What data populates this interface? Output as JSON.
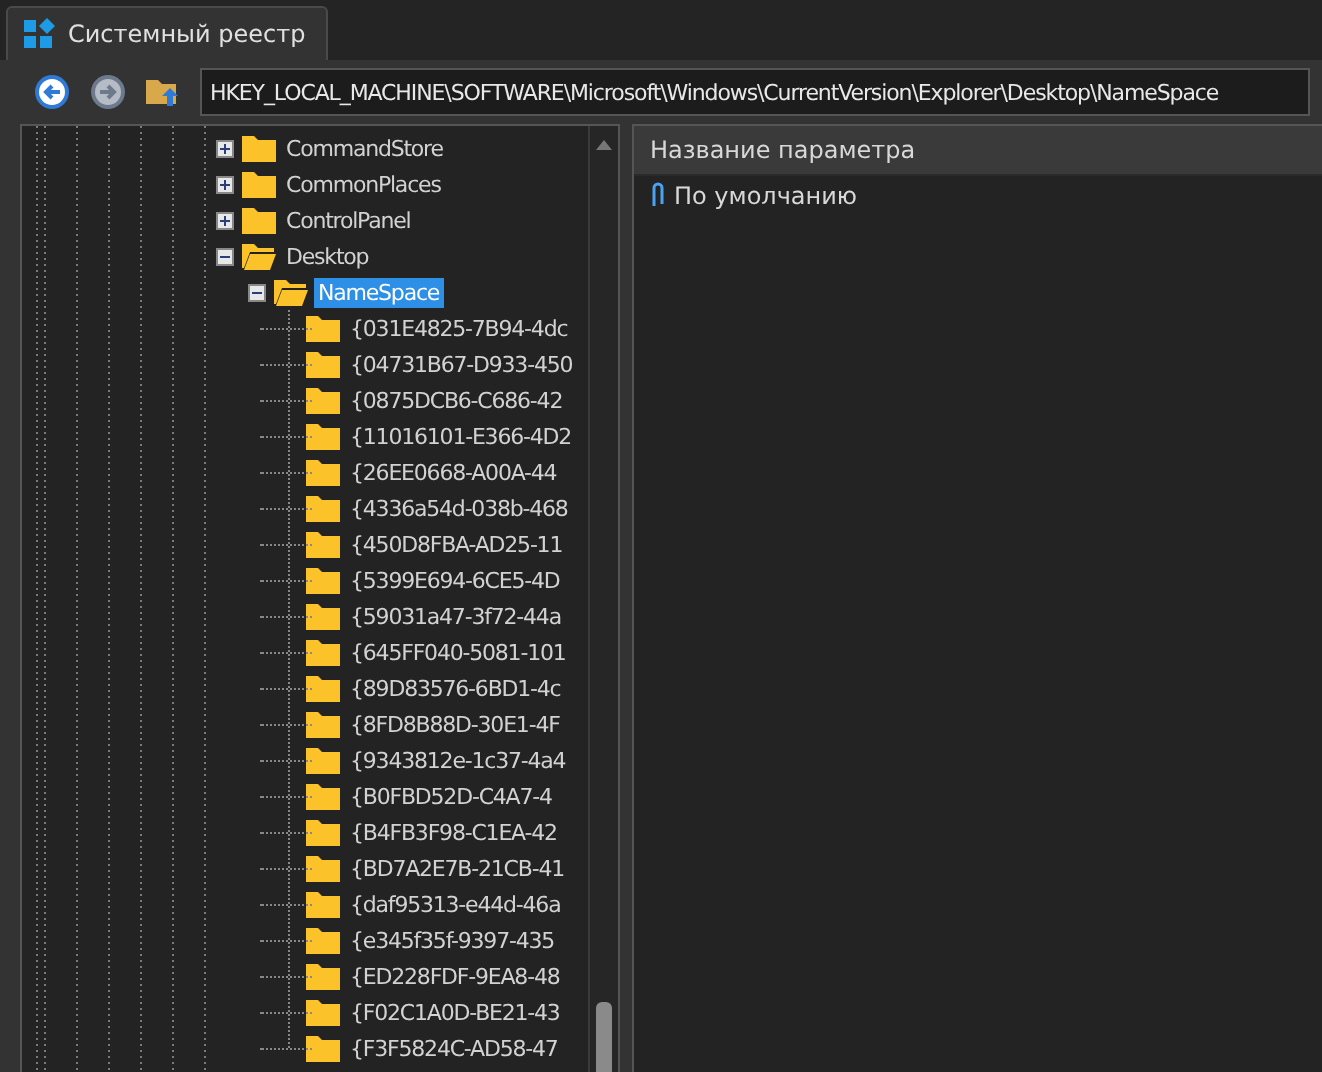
{
  "window": {
    "tab_title": "Системный реестр"
  },
  "toolbar": {
    "address": "HKEY_LOCAL_MACHINE\\SOFTWARE\\Microsoft\\Windows\\CurrentVersion\\Explorer\\Desktop\\NameSpace",
    "back_disabled": false,
    "forward_disabled": true
  },
  "tree": [
    {
      "label": "CommandStore",
      "expanded": false,
      "selected": false
    },
    {
      "label": "CommonPlaces",
      "expanded": false,
      "selected": false
    },
    {
      "label": "ControlPanel",
      "expanded": false,
      "selected": false
    },
    {
      "label": "Desktop",
      "expanded": true,
      "selected": false,
      "children": [
        {
          "label": "NameSpace",
          "expanded": true,
          "selected": true,
          "children": [
            {
              "label": "{031E4825-7B94-4dc",
              "selected": false
            },
            {
              "label": "{04731B67-D933-450",
              "selected": false
            },
            {
              "label": "{0875DCB6-C686-42",
              "selected": false
            },
            {
              "label": "{11016101-E366-4D2",
              "selected": false
            },
            {
              "label": "{26EE0668-A00A-44",
              "selected": false
            },
            {
              "label": "{4336a54d-038b-468",
              "selected": false
            },
            {
              "label": "{450D8FBA-AD25-11",
              "selected": false
            },
            {
              "label": "{5399E694-6CE5-4D",
              "selected": false
            },
            {
              "label": "{59031a47-3f72-44a",
              "selected": false
            },
            {
              "label": "{645FF040-5081-101",
              "selected": false
            },
            {
              "label": "{89D83576-6BD1-4c",
              "selected": false
            },
            {
              "label": "{8FD8B88D-30E1-4F",
              "selected": false
            },
            {
              "label": "{9343812e-1c37-4a4",
              "selected": false
            },
            {
              "label": "{B0FBD52D-C4A7-4",
              "selected": false
            },
            {
              "label": "{B4FB3F98-C1EA-42",
              "selected": false
            },
            {
              "label": "{BD7A2E7B-21CB-41",
              "selected": false
            },
            {
              "label": "{daf95313-e44d-46a",
              "selected": false
            },
            {
              "label": "{e345f35f-9397-435",
              "selected": false
            },
            {
              "label": "{ED228FDF-9EA8-48",
              "selected": false
            },
            {
              "label": "{F02C1A0D-BE21-43",
              "selected": false
            },
            {
              "label": "{F3F5824C-AD58-47",
              "selected": false
            }
          ]
        }
      ]
    }
  ],
  "values": {
    "columns": [
      "Название параметра"
    ],
    "rows": [
      {
        "name": "По умолчанию",
        "selected": false
      }
    ]
  }
}
